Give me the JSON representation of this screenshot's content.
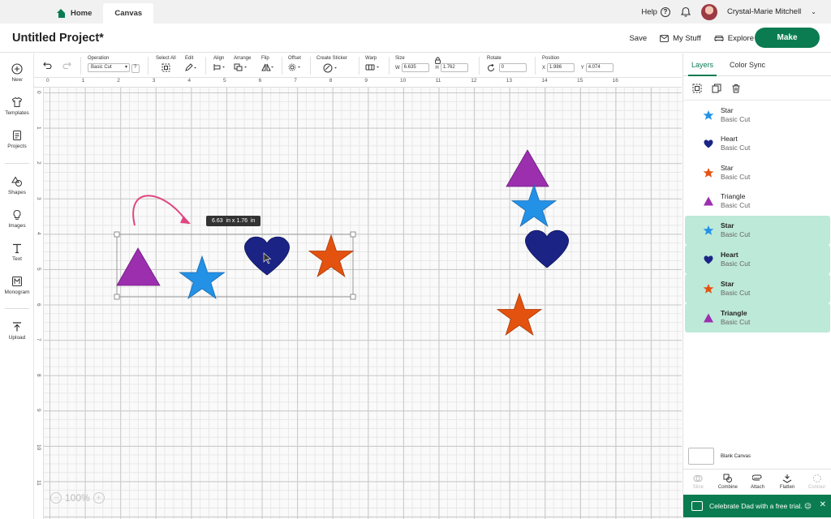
{
  "topbar": {
    "tabs": [
      {
        "label": "Home"
      },
      {
        "label": "Canvas"
      }
    ],
    "help_label": "Help",
    "user_name": "Crystal-Marie Mitchell"
  },
  "header": {
    "project_title": "Untitled Project*",
    "save_label": "Save",
    "mystuff_label": "My Stuff",
    "explore_label": "Explore",
    "make_label": "Make"
  },
  "left_rail": {
    "items": [
      {
        "label": "New",
        "icon": "plus-circle-icon"
      },
      {
        "label": "Templates",
        "icon": "shirt-icon"
      },
      {
        "label": "Projects",
        "icon": "document-icon"
      },
      {
        "label": "Shapes",
        "icon": "shapes-icon"
      },
      {
        "label": "Images",
        "icon": "lightbulb-icon"
      },
      {
        "label": "Text",
        "icon": "text-icon"
      },
      {
        "label": "Monogram",
        "icon": "monogram-icon"
      },
      {
        "label": "Upload",
        "icon": "upload-icon"
      }
    ]
  },
  "toolbar": {
    "operation_label": "Operation",
    "operation_value": "Basic Cut",
    "help_q": "?",
    "select_all_label": "Select All",
    "edit_label": "Edit",
    "align_label": "Align",
    "arrange_label": "Arrange",
    "flip_label": "Flip",
    "offset_label": "Offset",
    "create_sticker_label": "Create Sticker",
    "warp_label": "Warp",
    "size_label": "Size",
    "w_label": "W",
    "w_value": "6.635",
    "h_label": "H",
    "h_value": "1.762",
    "rotate_label": "Rotate",
    "rotate_value": "0",
    "position_label": "Position",
    "x_label": "X",
    "x_value": "1.986",
    "y_label": "Y",
    "y_value": "4.074"
  },
  "rulers": {
    "h": [
      "0",
      "1",
      "2",
      "3",
      "4",
      "5",
      "6",
      "7",
      "8",
      "9",
      "10",
      "11",
      "12",
      "13",
      "14",
      "15",
      "16"
    ],
    "v": [
      "0",
      "1",
      "2",
      "3",
      "4",
      "5",
      "6",
      "7",
      "8",
      "9",
      "10",
      "11"
    ]
  },
  "canvas": {
    "size_tooltip": "6.63  in x 1.76  in",
    "zoom_label": "100%",
    "colors": {
      "purple": "#9b2fae",
      "blue": "#2391e6",
      "navy": "#1b2485",
      "orange": "#e4520f",
      "arrow": "#e0457f"
    }
  },
  "right_panel": {
    "tabs": [
      {
        "label": "Layers"
      },
      {
        "label": "Color Sync"
      }
    ],
    "layers": [
      {
        "name": "Star",
        "op": "Basic Cut",
        "shape": "star",
        "color": "#2391e6",
        "selected": false
      },
      {
        "name": "Heart",
        "op": "Basic Cut",
        "shape": "heart",
        "color": "#1b2485",
        "selected": false
      },
      {
        "name": "Star",
        "op": "Basic Cut",
        "shape": "star",
        "color": "#e4520f",
        "selected": false
      },
      {
        "name": "Triangle",
        "op": "Basic Cut",
        "shape": "triangle",
        "color": "#9b2fae",
        "selected": false
      },
      {
        "name": "Star",
        "op": "Basic Cut",
        "shape": "star",
        "color": "#2391e6",
        "selected": true
      },
      {
        "name": "Heart",
        "op": "Basic Cut",
        "shape": "heart",
        "color": "#1b2485",
        "selected": true
      },
      {
        "name": "Star",
        "op": "Basic Cut",
        "shape": "star",
        "color": "#e4520f",
        "selected": true
      },
      {
        "name": "Triangle",
        "op": "Basic Cut",
        "shape": "triangle",
        "color": "#9b2fae",
        "selected": true
      }
    ],
    "blank_canvas_label": "Blank Canvas",
    "bottom_buttons": [
      {
        "label": "Slice",
        "enabled": false
      },
      {
        "label": "Combine",
        "enabled": true
      },
      {
        "label": "Attach",
        "enabled": true
      },
      {
        "label": "Flatten",
        "enabled": true
      },
      {
        "label": "Contour",
        "enabled": false
      }
    ]
  },
  "promo": {
    "text": "Celebrate Dad with a free trial. 😉",
    "close": "✕"
  }
}
